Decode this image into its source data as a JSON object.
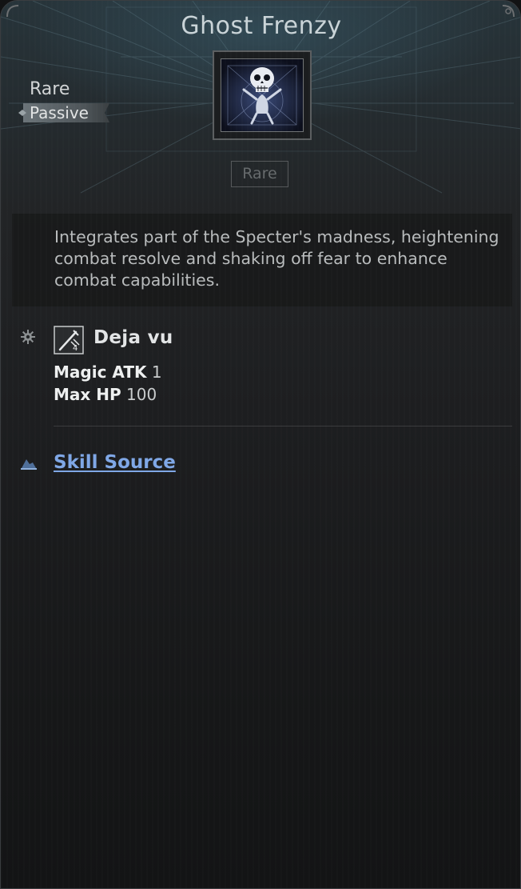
{
  "tooltip": {
    "title": "Ghost Frenzy",
    "rarity": "Rare",
    "skill_type": "Passive",
    "rarity_badge": "Rare",
    "description": "Integrates part of the Specter's madness, heightening combat resolve and shaking off fear to enhance combat capabilities.",
    "effect": {
      "name": "Deja vu",
      "stats": [
        {
          "label": "Magic ATK",
          "value": "1"
        },
        {
          "label": "Max HP",
          "value": "100"
        }
      ]
    },
    "source_link": "Skill Source"
  },
  "colors": {
    "title": "#c9d3d7",
    "link": "#7fa7e6",
    "panel_top": "#27343a",
    "panel_bottom": "#131415"
  },
  "icons": {
    "skill": "skull-specter-icon",
    "rarity_tag": "passive-tag-icon",
    "effect_bullet": "gear-icon",
    "effect": "dagger-icon",
    "source": "scroll-icon"
  }
}
